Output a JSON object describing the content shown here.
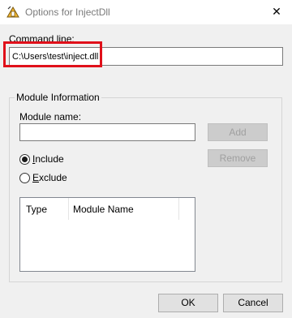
{
  "window": {
    "title": "Options for InjectDll",
    "close_glyph": "✕"
  },
  "command_line": {
    "label_underlined": "C",
    "label_rest": "ommand line:",
    "value": "C:\\Users\\test\\inject.dll"
  },
  "module_info": {
    "title": "Module Information",
    "name_label": "Module name:",
    "name_value": "",
    "add_label": "Add",
    "remove_label": "Remove",
    "include_underlined": "I",
    "include_rest": "nclude",
    "exclude_underlined": "E",
    "exclude_rest": "xclude",
    "include_selected": true,
    "columns": [
      "Type",
      "Module Name"
    ]
  },
  "footer": {
    "ok_label": "OK",
    "cancel_label": "Cancel"
  },
  "colors": {
    "highlight": "#e0101a",
    "accent": "#0078d7"
  }
}
